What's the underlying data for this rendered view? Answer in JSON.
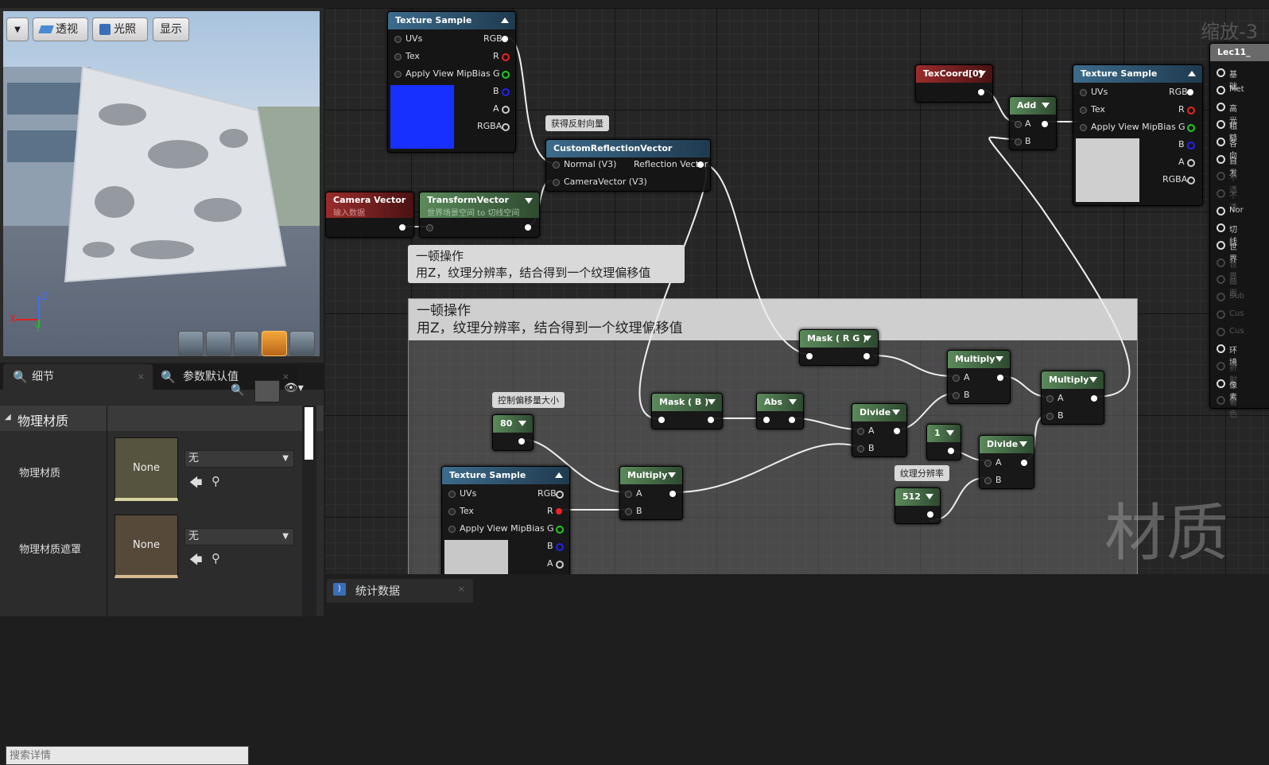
{
  "viewport": {
    "buttons": [
      {
        "label": "透视",
        "icon": "perspective-icon"
      },
      {
        "label": "光照",
        "icon": "lit-icon"
      },
      {
        "label": "显示"
      }
    ],
    "axis": {
      "z": "Z",
      "x": "X",
      "y": "Y"
    }
  },
  "details": {
    "tabs": [
      "细节",
      "参数默认值"
    ],
    "search_placeholder": "搜索详情",
    "category": "物理材质",
    "properties": [
      {
        "label": "物理材质",
        "swatch": "None",
        "value": "无"
      },
      {
        "label": "物理材质遮罩",
        "swatch": "None",
        "value": "无"
      }
    ]
  },
  "graph": {
    "zoom": "缩放-3",
    "watermark": "材质",
    "comment_top": {
      "line1": "一顿操作",
      "line2": "用Z，纹理分辨率，结合得到一个纹理偏移值"
    },
    "comment_box": {
      "line1": "一顿操作",
      "line2": "用Z，纹理分辨率，结合得到一个纹理偏移值"
    },
    "comment_reflect": "获得反射向量",
    "comment_offset": "控制偏移量大小",
    "comment_res": "纹理分辨率",
    "nodes": {
      "ts1": {
        "title": "Texture Sample",
        "inputs": [
          "UVs",
          "Tex",
          "Apply View MipBias"
        ],
        "outputs": [
          "RGB",
          "R",
          "G",
          "B",
          "A",
          "RGBA"
        ]
      },
      "ts2": {
        "title": "Texture Sample",
        "inputs": [
          "UVs",
          "Tex",
          "Apply View MipBias"
        ],
        "outputs": [
          "RGB",
          "R",
          "G",
          "B",
          "A",
          "RGBA"
        ]
      },
      "ts3": {
        "title": "Texture Sample",
        "inputs": [
          "UVs",
          "Tex",
          "Apply View MipBias"
        ],
        "outputs": [
          "RGB",
          "R",
          "G",
          "B",
          "A"
        ]
      },
      "crv": {
        "title": "CustomReflectionVector",
        "inputs": [
          "Normal (V3)",
          "CameraVector (V3)"
        ],
        "outputs": [
          "Reflection Vector"
        ]
      },
      "camera": {
        "title": "Camera Vector",
        "subtitle": "输入数据"
      },
      "transform": {
        "title": "TransformVector",
        "subtitle": "世界场景空间 to 切线空间"
      },
      "texcoord": {
        "title": "TexCoord[0]"
      },
      "add": {
        "title": "Add",
        "inputs": [
          "A",
          "B"
        ]
      },
      "maskrg": {
        "title": "Mask ( R G )"
      },
      "maskb": {
        "title": "Mask ( B )"
      },
      "abs": {
        "title": "Abs"
      },
      "c80": {
        "title": "80"
      },
      "c1": {
        "title": "1"
      },
      "c512": {
        "title": "512"
      },
      "divide1": {
        "title": "Divide",
        "inputs": [
          "A",
          "B"
        ]
      },
      "divide2": {
        "title": "Divide",
        "inputs": [
          "A",
          "B"
        ]
      },
      "multiply1": {
        "title": "Multiply",
        "inputs": [
          "A",
          "B"
        ]
      },
      "multiply2": {
        "title": "Multiply",
        "inputs": [
          "A",
          "B"
        ]
      },
      "multiply3": {
        "title": "Multiply",
        "inputs": [
          "A",
          "B"
        ]
      }
    },
    "result_node": {
      "title": "Lec11_",
      "pins": [
        {
          "label": "基础",
          "dim": false
        },
        {
          "label": "Met",
          "dim": false
        },
        {
          "label": "高光",
          "dim": false
        },
        {
          "label": "粗糙",
          "dim": false
        },
        {
          "label": "各向",
          "dim": false
        },
        {
          "label": "自发",
          "dim": false
        },
        {
          "label": "不透",
          "dim": true
        },
        {
          "label": "不透",
          "dim": true
        },
        {
          "label": "Nor",
          "dim": false
        },
        {
          "label": "切线",
          "dim": false
        },
        {
          "label": "世界",
          "dim": false
        },
        {
          "label": "世界",
          "dim": true
        },
        {
          "label": "曲面",
          "dim": true
        },
        {
          "label": "Sub",
          "dim": true
        },
        {
          "label": "Cus",
          "dim": true
        },
        {
          "label": "Cus",
          "dim": true
        },
        {
          "label": "环境",
          "dim": false
        },
        {
          "label": "折射",
          "dim": true
        },
        {
          "label": "像素",
          "dim": false
        },
        {
          "label": "着色",
          "dim": true
        }
      ]
    }
  },
  "statusbar": {
    "tab": "统计数据"
  }
}
